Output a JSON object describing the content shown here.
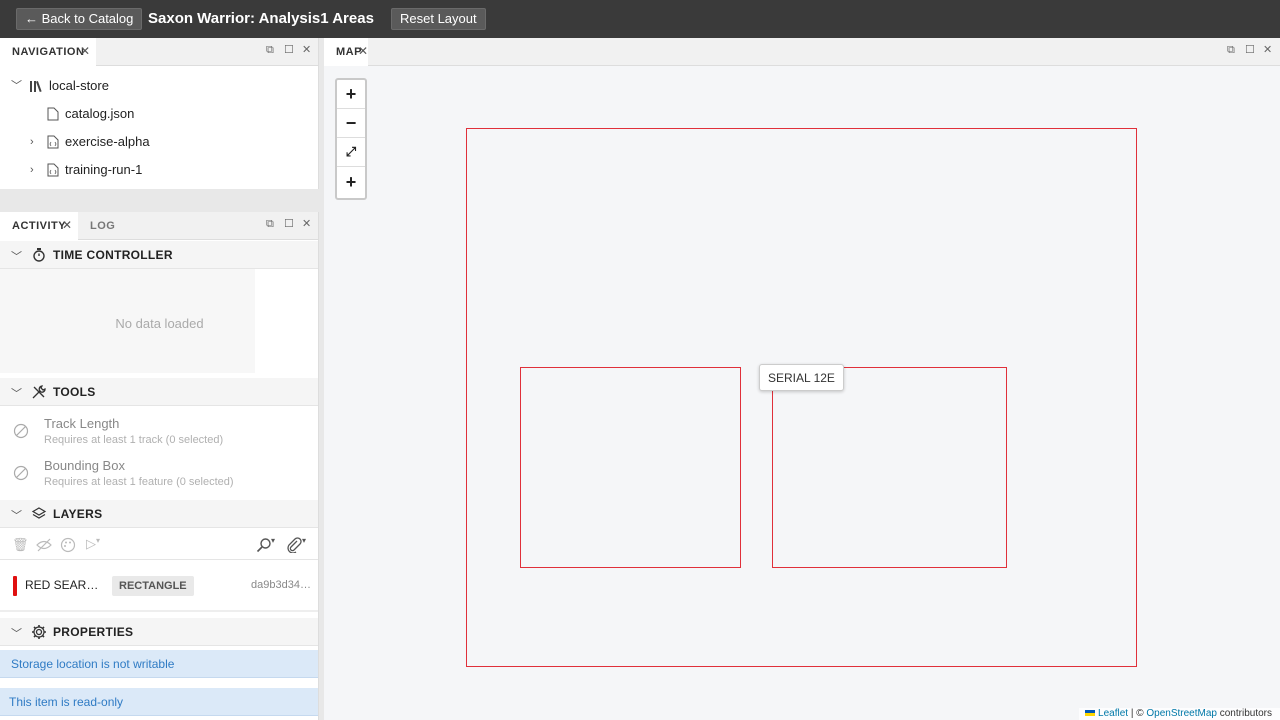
{
  "topbar": {
    "back_label": "← Back to Catalog",
    "title": "Saxon Warrior: Analysis1 Areas",
    "reset_label": "Reset Layout"
  },
  "navigation": {
    "tab_label": "NAVIGATION",
    "items": [
      {
        "label": "local-store",
        "icon": "library-icon",
        "expanded": true
      },
      {
        "label": "catalog.json",
        "icon": "file-icon"
      },
      {
        "label": "exercise-alpha",
        "icon": "code-file-icon",
        "expanded": false
      },
      {
        "label": "training-run-1",
        "icon": "code-file-icon",
        "expanded": false
      }
    ]
  },
  "activity": {
    "tabs": [
      "ACTIVITY",
      "LOG"
    ],
    "time_controller": {
      "label": "TIME CONTROLLER",
      "empty_text": "No data loaded"
    },
    "tools": {
      "label": "TOOLS",
      "items": [
        {
          "title": "Track Length",
          "subtitle": "Requires at least 1 track (0 selected)"
        },
        {
          "title": "Bounding Box",
          "subtitle": "Requires at least 1 feature (0 selected)"
        }
      ]
    },
    "layers": {
      "label": "LAYERS",
      "rows": [
        {
          "name": "RED SEAR…",
          "type": "RECTANGLE",
          "id": "da9b3d34…",
          "color": "#e01010"
        }
      ]
    },
    "properties": {
      "label": "PROPERTIES",
      "alerts": [
        "Storage location is not writable",
        "This item is read-only"
      ]
    }
  },
  "map": {
    "tab_label": "MAP",
    "tooltip": "SERIAL 12E",
    "shape_color": "#e0303a",
    "attribution": {
      "leaflet": "Leaflet",
      "sep": " | © ",
      "osm": "OpenStreetMap",
      "suffix": " contributors"
    }
  }
}
